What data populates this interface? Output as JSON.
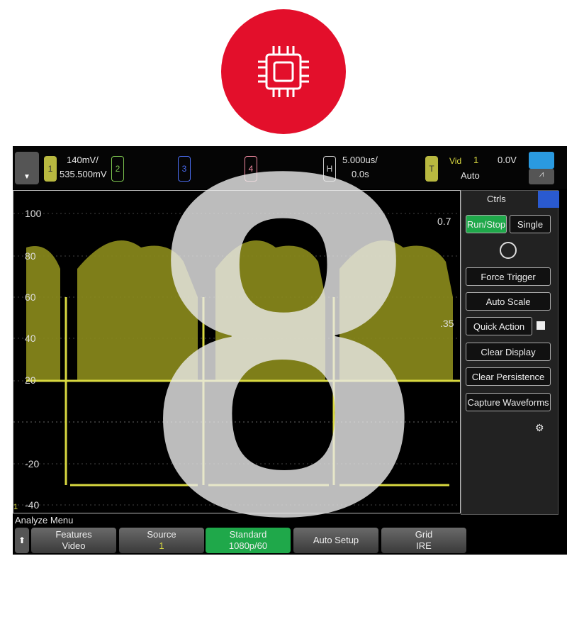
{
  "logo": {
    "icon": "cpu-chip-icon",
    "color": "#e30f2b"
  },
  "overlay_number": "8",
  "header": {
    "ch1": "1",
    "ch1_scale": "140mV/",
    "ch1_offset": "535.500mV",
    "ch2": "2",
    "ch3": "3",
    "ch4": "4",
    "h": "H",
    "time_scale": "5.000us/",
    "time_offset": "0.0s",
    "trig": "T",
    "trig_type": "Vid",
    "trig_src": "1",
    "trig_level": "0.0V",
    "trig_mode": "Auto"
  },
  "graticule": {
    "y_labels": [
      "100",
      "80",
      "60",
      "40",
      "20",
      "-20",
      "-40"
    ],
    "right_labels": [
      "0.7",
      ".35"
    ],
    "ground_marker": "1"
  },
  "panel": {
    "title": "Ctrls",
    "run_stop": "Run/Stop",
    "single": "Single",
    "buttons": [
      "Force Trigger",
      "Auto Scale",
      "Quick Action",
      "Clear Display",
      "Clear Persistence",
      "Capture Waveforms"
    ]
  },
  "menu": {
    "title": "Analyze Menu",
    "softkeys": [
      {
        "label": "Features",
        "value": "Video"
      },
      {
        "label": "Source",
        "value": "1"
      },
      {
        "label": "Standard",
        "value": "1080p/60"
      },
      {
        "label": "Auto Setup",
        "value": ""
      },
      {
        "label": "Grid",
        "value": "IRE"
      }
    ]
  },
  "colors": {
    "ch1": "#d8d840",
    "ch2": "#7ec850",
    "ch3": "#4a6cf0",
    "ch4": "#f08aa0",
    "run": "#1fa84a",
    "accent": "#2a8ad8"
  }
}
